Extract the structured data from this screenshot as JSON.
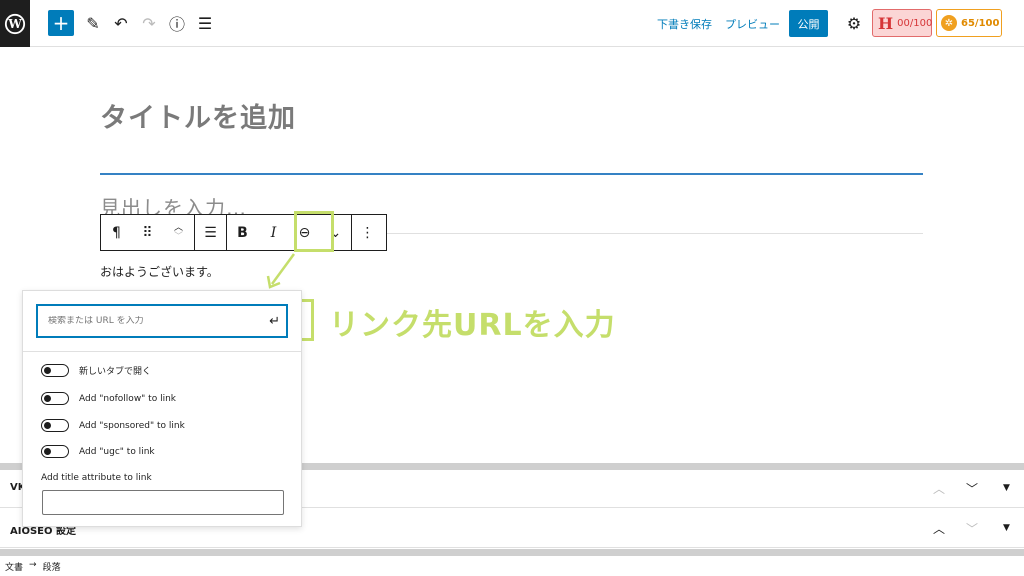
{
  "topbar": {
    "save_draft": "下書き保存",
    "preview": "プレビュー",
    "publish": "公開",
    "headline_score": "00/100",
    "seo_score": "65/100"
  },
  "editor": {
    "title_placeholder": "タイトルを追加",
    "heading_placeholder": "見出しを入力…",
    "paragraph_text": "おはようございます。"
  },
  "annotation": {
    "label": "リンク先URLを入力",
    "highlight_color": "#c5de6b"
  },
  "link_popover": {
    "url_placeholder": "検索または URL を入力",
    "toggles": [
      {
        "label": "新しいタブで開く",
        "checked": false
      },
      {
        "label": "Add \"nofollow\" to link",
        "checked": false
      },
      {
        "label": "Add \"sponsored\" to link",
        "checked": false
      },
      {
        "label": "Add \"ugc\" to link",
        "checked": false
      }
    ],
    "title_attr_label": "Add title attribute to link",
    "title_attr_value": ""
  },
  "meta_boxes": [
    {
      "title": "VK"
    },
    {
      "title": "AIOSEO 設定"
    }
  ],
  "breadcrumb": {
    "root": "文書",
    "arrow": "→",
    "current": "段落"
  },
  "colors": {
    "accent": "#007cba",
    "focus_line": "#3582c4"
  }
}
